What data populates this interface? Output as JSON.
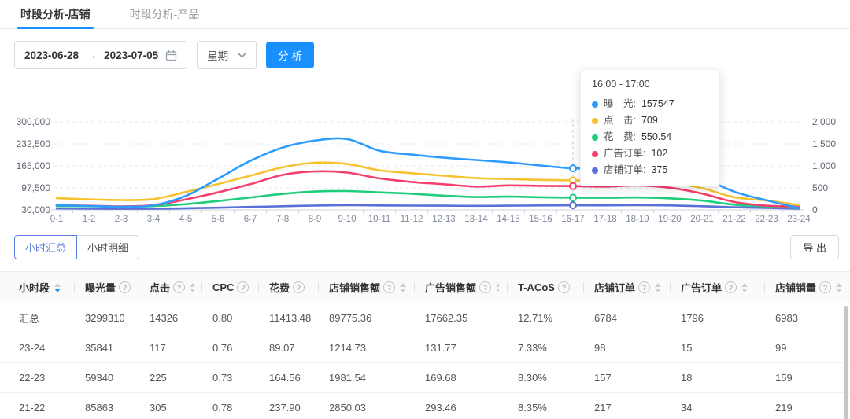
{
  "tabs": [
    {
      "label": "时段分析-店铺",
      "active": true
    },
    {
      "label": "时段分析-产品",
      "active": false
    }
  ],
  "controls": {
    "date_start": "2023-06-28",
    "date_arrow": "→",
    "date_end": "2023-07-05",
    "granularity": "星期",
    "analyze_label": "分 析"
  },
  "accent_colors": {
    "tab_underline": "#1890ff",
    "analyze_button": "#1890ff",
    "active_view_button": "#5b7ce0"
  },
  "chart_data": {
    "type": "line",
    "x": [
      "0-1",
      "1-2",
      "2-3",
      "3-4",
      "4-5",
      "5-6",
      "6-7",
      "7-8",
      "8-9",
      "9-10",
      "10-11",
      "11-12",
      "12-13",
      "13-14",
      "14-15",
      "15-16",
      "16-17",
      "17-18",
      "18-19",
      "19-20",
      "20-21",
      "21-22",
      "22-23",
      "23-24"
    ],
    "left_axis": {
      "ticks": [
        "300,000",
        "232,500",
        "165,000",
        "97,500",
        "30,000"
      ],
      "min": 30000,
      "max": 300000
    },
    "right_axis": {
      "ticks": [
        "2,000",
        "1,500",
        "1,000",
        "500",
        "0"
      ],
      "min": 0,
      "max": 2000
    },
    "grid": "dashed",
    "highlight_index": 16,
    "series": [
      {
        "name": "曝光",
        "color": "#2d9cff",
        "axis": "left",
        "band": 112,
        "values": [
          44300,
          42000,
          39600,
          44300,
          73000,
          125600,
          180500,
          221100,
          242600,
          247400,
          211600,
          199600,
          190000,
          183000,
          175800,
          166200,
          157547,
          157000,
          160000,
          150000,
          128000,
          85863,
          59340,
          35841
        ]
      },
      {
        "name": "点击",
        "color": "#f6c22e",
        "axis": "own",
        "band": 60,
        "values": [
          280,
          255,
          235,
          260,
          430,
          620,
          820,
          1020,
          1130,
          1100,
          950,
          880,
          820,
          760,
          740,
          720,
          709,
          700,
          710,
          650,
          520,
          305,
          225,
          117
        ]
      },
      {
        "name": "花费",
        "color": "#1ece7a",
        "axis": "own",
        "band": 24,
        "values": [
          180,
          165,
          150,
          170,
          260,
          400,
          560,
          720,
          830,
          850,
          790,
          730,
          640,
          580,
          600,
          570,
          550.54,
          545,
          560,
          520,
          420,
          237.9,
          164.56,
          89.07
        ]
      },
      {
        "name": "广告订单",
        "color": "#f43f6e",
        "axis": "own",
        "band": 49,
        "values": [
          20,
          18,
          15,
          20,
          45,
          75,
          110,
          150,
          165,
          160,
          135,
          120,
          110,
          100,
          105,
          103,
          102,
          100,
          105,
          95,
          70,
          34,
          18,
          15
        ]
      },
      {
        "name": "店铺订单",
        "color": "#5a6fd8",
        "axis": "own",
        "band": 6,
        "values": [
          120,
          100,
          90,
          95,
          130,
          180,
          240,
          300,
          350,
          380,
          360,
          350,
          340,
          330,
          340,
          360,
          375,
          370,
          380,
          360,
          300,
          217,
          157,
          98
        ]
      }
    ]
  },
  "tooltip": {
    "title": "16:00 - 17:00",
    "items": [
      {
        "label": "曝　光:",
        "value": "157547",
        "color": "#2d9cff"
      },
      {
        "label": "点　击:",
        "value": "709",
        "color": "#f6c22e"
      },
      {
        "label": "花　费:",
        "value": "550.54",
        "color": "#1ece7a"
      },
      {
        "label": "广告订单:",
        "value": "102",
        "color": "#f43f6e"
      },
      {
        "label": "店铺订单:",
        "value": "375",
        "color": "#5a6fd8"
      }
    ]
  },
  "view_buttons": [
    {
      "label": "小时汇总",
      "active": true
    },
    {
      "label": "小时明细",
      "active": false
    }
  ],
  "export_label": "导 出",
  "table": {
    "columns": [
      {
        "label": "小时段",
        "help": false,
        "sorted": "desc"
      },
      {
        "label": "曝光量",
        "help": true
      },
      {
        "label": "点击",
        "help": true
      },
      {
        "label": "CPC",
        "help": true
      },
      {
        "label": "花费",
        "help": true
      },
      {
        "label": "店铺销售额",
        "help": true
      },
      {
        "label": "广告销售额",
        "help": true
      },
      {
        "label": "T-ACoS",
        "help": true
      },
      {
        "label": "店铺订单",
        "help": true
      },
      {
        "label": "广告订单",
        "help": true
      },
      {
        "label": "店铺销量",
        "help": true
      }
    ],
    "rows": [
      [
        "汇总",
        "3299310",
        "14326",
        "0.80",
        "11413.48",
        "89775.36",
        "17662.35",
        "12.71%",
        "6784",
        "1796",
        "6983"
      ],
      [
        "23-24",
        "35841",
        "117",
        "0.76",
        "89.07",
        "1214.73",
        "131.77",
        "7.33%",
        "98",
        "15",
        "99"
      ],
      [
        "22-23",
        "59340",
        "225",
        "0.73",
        "164.56",
        "1981.54",
        "169.68",
        "8.30%",
        "157",
        "18",
        "159"
      ],
      [
        "21-22",
        "85863",
        "305",
        "0.78",
        "237.90",
        "2850.03",
        "293.46",
        "8.35%",
        "217",
        "34",
        "219"
      ]
    ]
  }
}
